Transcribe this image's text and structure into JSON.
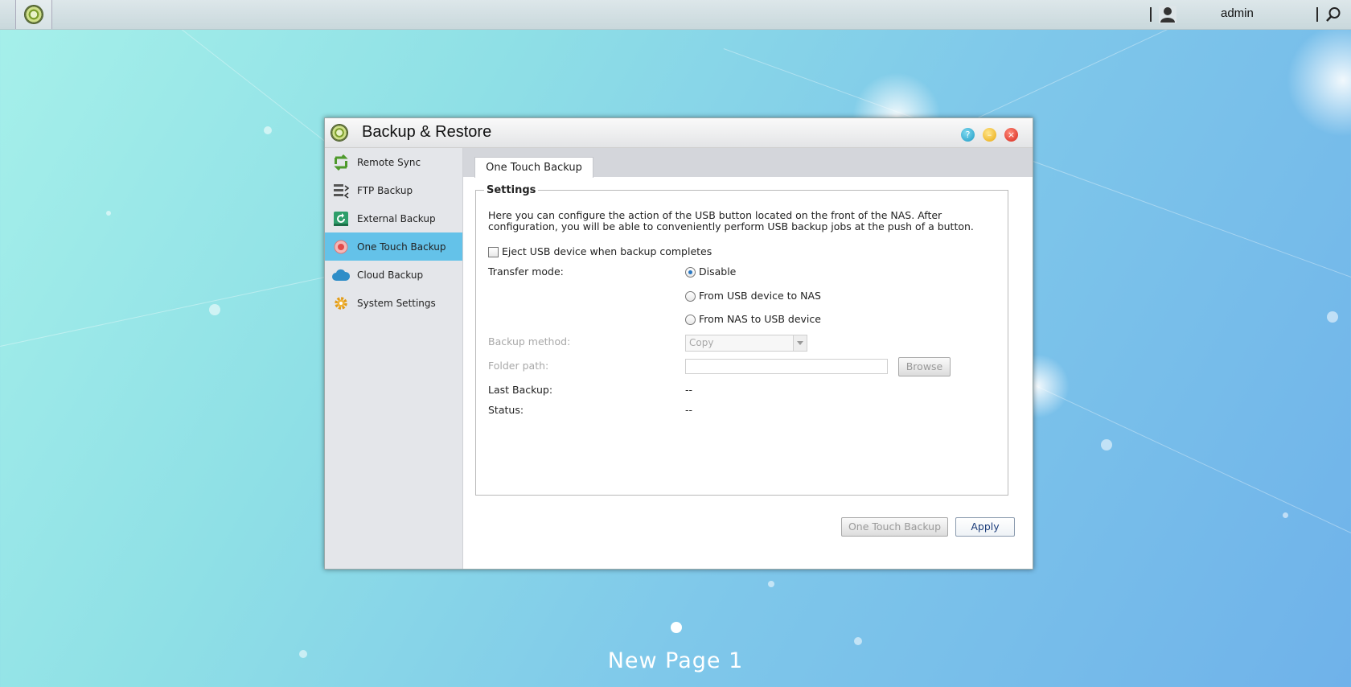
{
  "topbar": {
    "username": "admin",
    "home_icon": "app-logo-icon",
    "user_icon": "user-icon",
    "search_icon": "search-icon"
  },
  "window": {
    "title": "Backup & Restore",
    "controls": [
      "help-icon",
      "minimize-icon",
      "close-icon"
    ]
  },
  "sidebar": {
    "items": [
      {
        "label": "Remote Sync",
        "icon": "remote-sync-icon"
      },
      {
        "label": "FTP Backup",
        "icon": "ftp-backup-icon"
      },
      {
        "label": "External Backup",
        "icon": "external-backup-icon"
      },
      {
        "label": "One Touch Backup",
        "icon": "one-touch-backup-icon",
        "active": true
      },
      {
        "label": "Cloud Backup",
        "icon": "cloud-icon"
      },
      {
        "label": "System Settings",
        "icon": "gear-icon"
      }
    ]
  },
  "main": {
    "tab": "One Touch Backup",
    "settings": {
      "legend": "Settings",
      "description": "Here you can configure the action of the USB button located on the front of the NAS. After configuration, you will be able to conveniently perform USB backup jobs at the push of a button.",
      "eject_label": "Eject USB device when backup completes",
      "eject_checked": false,
      "transfer_mode_label": "Transfer mode:",
      "transfer_options": [
        "Disable",
        "From USB device to NAS",
        "From NAS to USB device"
      ],
      "transfer_selected": "Disable",
      "backup_method_label": "Backup method:",
      "backup_method_value": "Copy",
      "folder_path_label": "Folder path:",
      "folder_path_value": "",
      "browse_label": "Browse",
      "last_backup_label": "Last Backup:",
      "last_backup_value": "--",
      "status_label": "Status:",
      "status_value": "--"
    },
    "buttons": {
      "one_touch_backup": "One Touch Backup",
      "apply": "Apply"
    }
  },
  "desktop": {
    "page_label": "New Page 1"
  },
  "colors": {
    "active_nav": "#64c2e9",
    "desktop_bg": "#8fd6e8"
  }
}
